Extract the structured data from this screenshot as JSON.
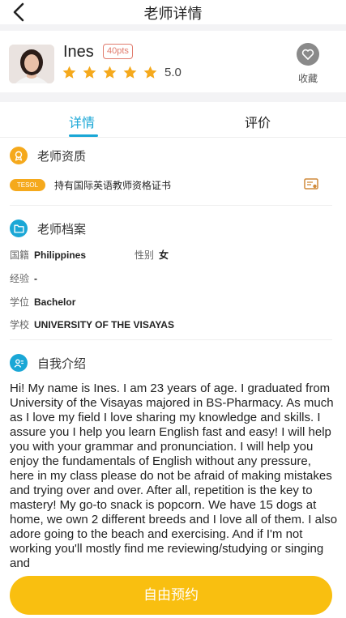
{
  "header": {
    "title": "老师详情",
    "back_icon": "chevron-left-icon"
  },
  "profile": {
    "name": "Ines",
    "points_badge": "40pts",
    "rating": "5.0",
    "stars_filled": 5,
    "star_color": "#f5a91c",
    "favorite_label": "收藏",
    "favorite_icon": "heart-icon"
  },
  "tabs": [
    {
      "label": "详情",
      "active": true
    },
    {
      "label": "评价",
      "active": false
    }
  ],
  "qualification": {
    "title": "老师资质",
    "badge": "TESOL",
    "text": "持有国际英语教师资格证书",
    "icon": "certificate-icon"
  },
  "profile_file": {
    "title": "老师档案",
    "fields": {
      "nationality": {
        "label": "国籍",
        "value": "Philippines"
      },
      "gender": {
        "label": "性别",
        "value": "女"
      },
      "experience": {
        "label": "经验",
        "value": "-"
      },
      "degree": {
        "label": "学位",
        "value": "Bachelor"
      },
      "school": {
        "label": "学校",
        "value": "UNIVERSITY OF THE VISAYAS"
      }
    }
  },
  "intro": {
    "title": "自我介绍",
    "text": "Hi! My name is Ines. I am 23 years of age. I graduated from University of the Visayas majored in BS-Pharmacy. As much as I love my field I love sharing my knowledge and skills. I assure you I help you learn English fast and easy! I will help you with your grammar and pronunciation. I will help you enjoy the fundamentals of English without any pressure, here in my class please do not be afraid of making mistakes and trying over and over. After all, repetition is the key to mastery! My go-to snack is popcorn. We have 15 dogs at home, we own 2 different breeds and I love all of them. I also adore going to the beach and exercising. And if I'm not working you'll mostly find me reviewing/studying or singing and"
  },
  "actions": {
    "book_label": "自由预约"
  },
  "colors": {
    "accent": "#1aa7d6",
    "brand_yellow": "#f9bf10",
    "badge_red": "#e07a6c"
  }
}
